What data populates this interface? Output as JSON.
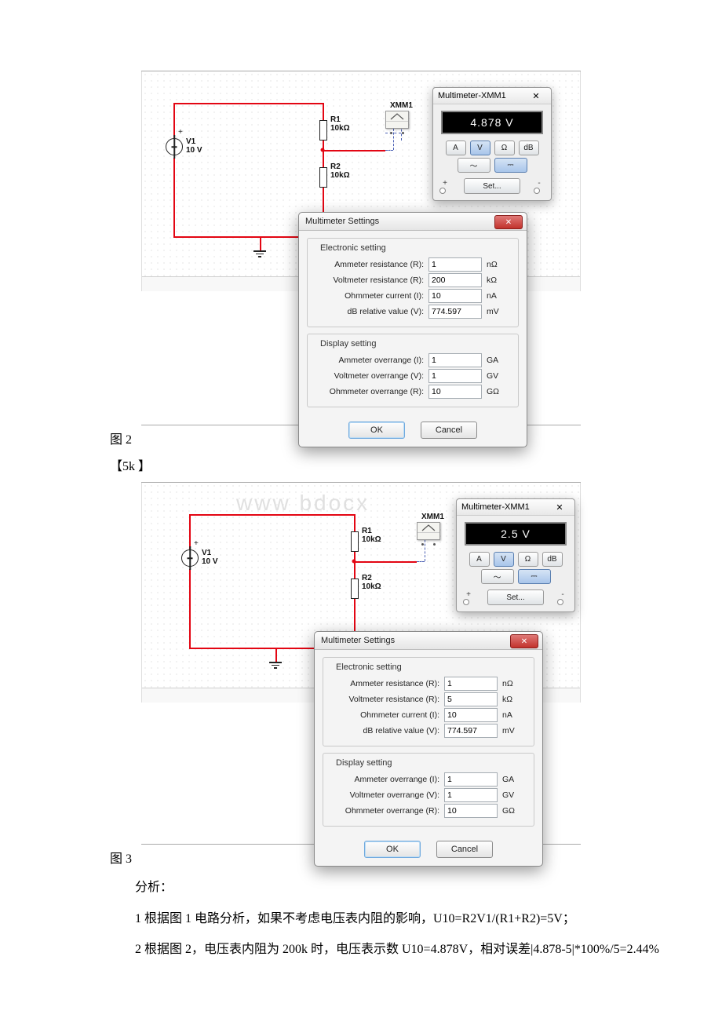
{
  "figures": [
    {
      "caption": "图 2",
      "note": "",
      "watermark": "",
      "circuit": {
        "source": {
          "name": "V1",
          "value": "10 V"
        },
        "r1": {
          "name": "R1",
          "value": "10kΩ"
        },
        "r2": {
          "name": "R2",
          "value": "10kΩ"
        },
        "mm_label": "XMM1"
      },
      "xmm": {
        "title": "Multimeter-XMM1",
        "close": "✕",
        "reading": "4.878 V",
        "modes": [
          "A",
          "V",
          "Ω",
          "dB"
        ],
        "set_label": "Set...",
        "plus": "+",
        "minus": "-"
      },
      "settings": {
        "title": "Multimeter Settings",
        "group1": "Electronic setting",
        "group2": "Display setting",
        "rows1": [
          {
            "label": "Ammeter resistance (R):",
            "value": "1",
            "unit": "nΩ"
          },
          {
            "label": "Voltmeter resistance (R):",
            "value": "200",
            "unit": "kΩ"
          },
          {
            "label": "Ohmmeter current (I):",
            "value": "10",
            "unit": "nA"
          },
          {
            "label": "dB relative value (V):",
            "value": "774.597",
            "unit": "mV"
          }
        ],
        "rows2": [
          {
            "label": "Ammeter overrange (I):",
            "value": "1",
            "unit": "GA"
          },
          {
            "label": "Voltmeter overrange (V):",
            "value": "1",
            "unit": "GV"
          },
          {
            "label": "Ohmmeter overrange (R):",
            "value": "10",
            "unit": "GΩ"
          }
        ],
        "ok": "OK",
        "cancel": "Cancel"
      }
    },
    {
      "caption": "图 3",
      "note": "【5k 】",
      "watermark": "www bdocx",
      "circuit": {
        "source": {
          "name": "V1",
          "value": "10 V"
        },
        "r1": {
          "name": "R1",
          "value": "10kΩ"
        },
        "r2": {
          "name": "R2",
          "value": "10kΩ"
        },
        "mm_label": "XMM1"
      },
      "xmm": {
        "title": "Multimeter-XMM1",
        "close": "✕",
        "reading": "2.5 V",
        "modes": [
          "A",
          "V",
          "Ω",
          "dB"
        ],
        "set_label": "Set...",
        "plus": "+",
        "minus": "-"
      },
      "settings": {
        "title": "Multimeter Settings",
        "group1": "Electronic setting",
        "group2": "Display setting",
        "rows1": [
          {
            "label": "Ammeter resistance (R):",
            "value": "1",
            "unit": "nΩ"
          },
          {
            "label": "Voltmeter resistance (R):",
            "value": "5",
            "unit": "kΩ"
          },
          {
            "label": "Ohmmeter current (I):",
            "value": "10",
            "unit": "nA"
          },
          {
            "label": "dB relative value (V):",
            "value": "774.597",
            "unit": "mV"
          }
        ],
        "rows2": [
          {
            "label": "Ammeter overrange (I):",
            "value": "1",
            "unit": "GA"
          },
          {
            "label": "Voltmeter overrange (V):",
            "value": "1",
            "unit": "GV"
          },
          {
            "label": "Ohmmeter overrange (R):",
            "value": "10",
            "unit": "GΩ"
          }
        ],
        "ok": "OK",
        "cancel": "Cancel"
      }
    }
  ],
  "analysis": {
    "heading": "分析：",
    "line1": "1   根据图 1 电路分析，如果不考虑电压表内阻的影响，U10=R2V1/(R1+R2)=5V；",
    "line2": "2   根据图 2，电压表内阻为 200k 时，电压表示数 U10=4.878V，相对误差|4.878-5|*100%/5=2.44%"
  }
}
